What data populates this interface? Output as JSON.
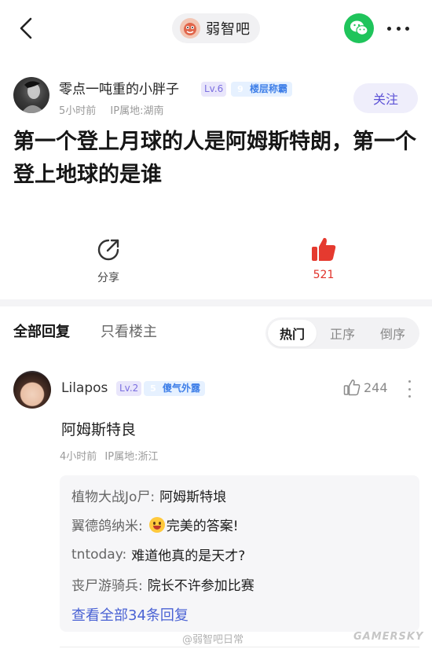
{
  "header": {
    "forum_name": "弱智吧"
  },
  "post": {
    "author": {
      "name": "零点一吨重的小胖子",
      "level": "Lv.6",
      "title_level": "9",
      "title": "楼层称霸",
      "time": "5小时前",
      "ip": "IP属地:湖南"
    },
    "follow_label": "关注",
    "title": "第一个登上月球的人是阿姆斯特朗，第一个登上地球的是谁",
    "share_label": "分享",
    "like_count": "521",
    "colors": {
      "like": "#e0322a",
      "accent": "#5c52d6"
    }
  },
  "replies": {
    "tab_all": "全部回复",
    "tab_op": "只看楼主",
    "sort": [
      "热门",
      "正序",
      "倒序"
    ],
    "sort_active": "热门",
    "comments": [
      {
        "user": "Lilapos",
        "level": "Lv.2",
        "title_level": "5",
        "title": "傻气外露",
        "likes": "244",
        "text": "阿姆斯特良",
        "time": "4小时前",
        "ip": "IP属地:浙江",
        "sub_replies": [
          {
            "user": "植物大战Jo尸:",
            "text": "阿姆斯特埌"
          },
          {
            "user": "翼德鸽纳米:",
            "emoji": "grinning-emoji",
            "text": "完美的答案!"
          },
          {
            "user": "tntoday:",
            "text": "难道他真的是天才?"
          },
          {
            "user": "丧尸游骑兵:",
            "text": "院长不许参加比赛"
          }
        ],
        "view_all": "查看全部34条回复"
      }
    ]
  },
  "watermarks": {
    "weibo": "@弱智吧日常",
    "site": "GAMERSKY"
  }
}
